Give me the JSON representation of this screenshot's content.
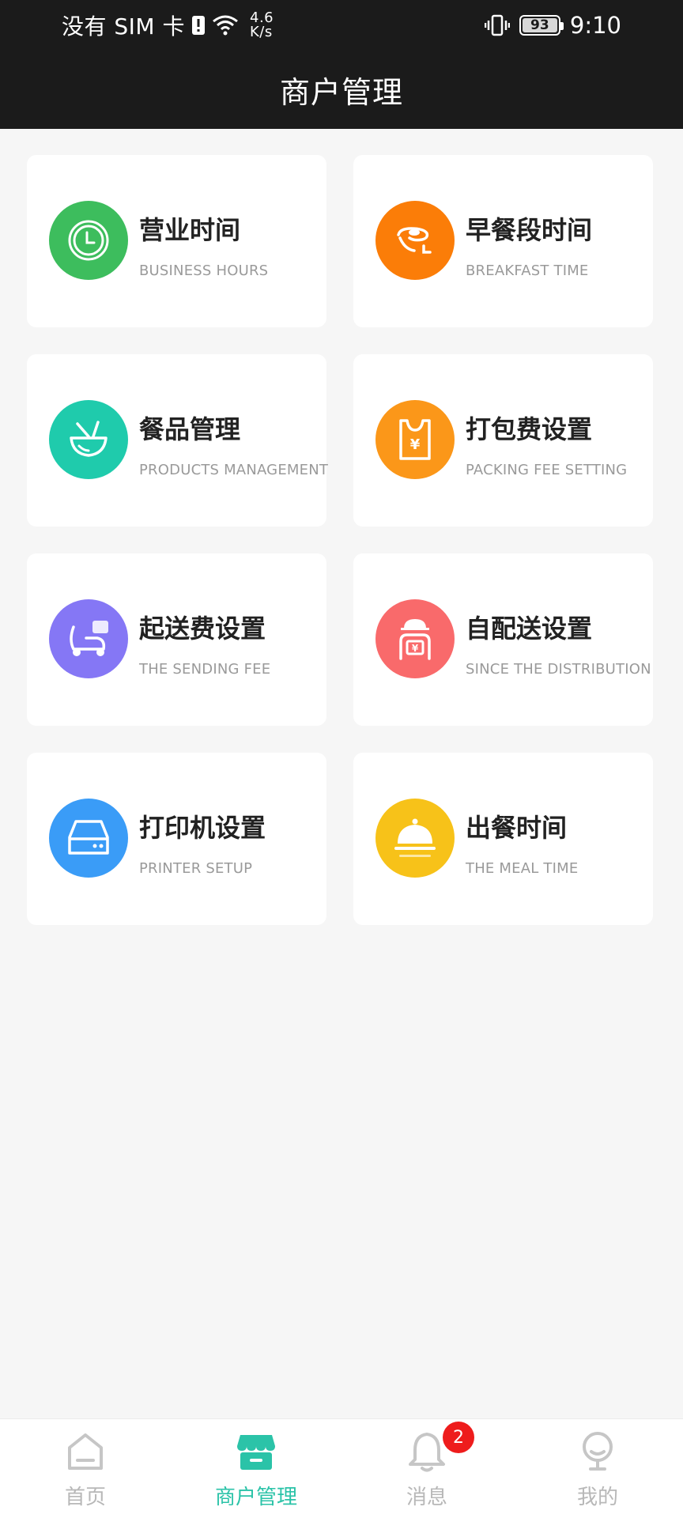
{
  "status_bar": {
    "carrier": "没有 SIM 卡",
    "speed_value": "4.6",
    "speed_unit": "K/s",
    "battery": "93",
    "time": "9:10"
  },
  "header": {
    "title": "商户管理"
  },
  "cards": [
    {
      "title": "营业时间",
      "subtitle": "BUSINESS HOURS",
      "icon": "clock-icon",
      "color": "#3dbd5d"
    },
    {
      "title": "早餐段时间",
      "subtitle": "BREAKFAST TIME",
      "icon": "breakfast-icon",
      "color": "#fb7d08"
    },
    {
      "title": "餐品管理",
      "subtitle": "PRODUCTS MANAGEMENT",
      "icon": "bowl-icon",
      "color": "#1fcbac"
    },
    {
      "title": "打包费设置",
      "subtitle": "PACKING FEE SETTING",
      "icon": "bag-icon",
      "color": "#fb9719"
    },
    {
      "title": "起送费设置",
      "subtitle": "THE SENDING FEE",
      "icon": "scooter-icon",
      "color": "#8577f5"
    },
    {
      "title": "自配送设置",
      "subtitle": "SINCE THE DISTRIBUTION",
      "icon": "courier-icon",
      "color": "#f96a6b"
    },
    {
      "title": "打印机设置",
      "subtitle": "PRINTER SETUP",
      "icon": "printer-icon",
      "color": "#3a9cf7"
    },
    {
      "title": "出餐时间",
      "subtitle": "THE MEAL TIME",
      "icon": "cloche-icon",
      "color": "#f7c219"
    }
  ],
  "nav": {
    "home": "首页",
    "merchant": "商户管理",
    "messages": "消息",
    "messages_badge": "2",
    "mine": "我的"
  }
}
